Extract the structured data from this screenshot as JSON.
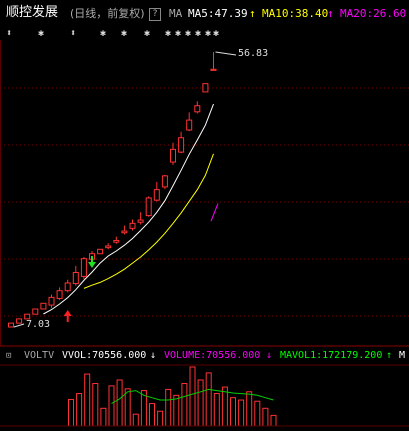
{
  "header": {
    "stock_name": "顺控发展",
    "period_info": "(日线，前复权)",
    "help_icon": "?",
    "ma_label": "MA",
    "ma5": "MA5:47.39",
    "ma10": "MA10:38.40",
    "ma20": "MA20:26.60",
    "up_arrow": "↑"
  },
  "markers": [
    "⬍",
    "✱",
    "⬍",
    "✱",
    "✱",
    "✱",
    "✱",
    "✱",
    "✱",
    "✱",
    "✱",
    "✱"
  ],
  "price_labels": {
    "high": "56.83",
    "low": "7.03"
  },
  "volume_header": {
    "indicator": "VOLTV",
    "vvol": "VVOL:70556.000",
    "volume": "VOLUME:70556.000",
    "mavol1": "MAVOL1:172179.200",
    "mavol_trunc": "M",
    "down_arrow": "↓",
    "up_arrow": "↑"
  },
  "colors": {
    "up": "#ff3232",
    "ma5": "#ffffff",
    "ma10": "#ffff00",
    "ma20": "#ff00ff",
    "grid": "#7a0000",
    "buy_signal": "#ff2020",
    "sell_signal": "#20e020",
    "vol_ma": "#00d000"
  },
  "chart_data": {
    "type": "candlestick",
    "price_range": [
      7.03,
      56.83
    ],
    "candles": [
      {
        "open": 7.03,
        "close": 7.73,
        "high": 7.73,
        "low": 7.03
      },
      {
        "open": 7.73,
        "close": 8.5,
        "high": 8.5,
        "low": 7.73
      },
      {
        "open": 8.5,
        "close": 9.35,
        "high": 9.35,
        "low": 8.5
      },
      {
        "open": 9.35,
        "close": 10.29,
        "high": 10.29,
        "low": 9.35
      },
      {
        "open": 10.29,
        "close": 11.32,
        "high": 11.32,
        "low": 10.29
      },
      {
        "open": 11.0,
        "close": 12.4,
        "high": 12.9,
        "low": 10.5
      },
      {
        "open": 12.2,
        "close": 13.6,
        "high": 14.2,
        "low": 11.9
      },
      {
        "open": 13.6,
        "close": 15.0,
        "high": 15.6,
        "low": 13.3
      },
      {
        "open": 14.9,
        "close": 16.9,
        "high": 18.1,
        "low": 14.5
      },
      {
        "open": 16.2,
        "close": 19.4,
        "high": 19.7,
        "low": 15.7
      },
      {
        "open": 19.3,
        "close": 20.3,
        "high": 20.8,
        "low": 18.9
      },
      {
        "open": 20.3,
        "close": 21.1,
        "high": 21.1,
        "low": 20.3
      },
      {
        "open": 21.4,
        "close": 21.7,
        "high": 22.2,
        "low": 21.1
      },
      {
        "open": 22.4,
        "close": 22.7,
        "high": 23.4,
        "low": 22.1
      },
      {
        "open": 24.1,
        "close": 24.4,
        "high": 25.4,
        "low": 23.8
      },
      {
        "open": 24.9,
        "close": 25.8,
        "high": 26.5,
        "low": 24.5
      },
      {
        "open": 26.0,
        "close": 26.4,
        "high": 27.8,
        "low": 25.6
      },
      {
        "open": 27.2,
        "close": 30.4,
        "high": 30.7,
        "low": 27.0
      },
      {
        "open": 30.0,
        "close": 31.9,
        "high": 33.3,
        "low": 29.8
      },
      {
        "open": 32.4,
        "close": 34.4,
        "high": 34.6,
        "low": 32.0
      },
      {
        "open": 36.9,
        "close": 39.2,
        "high": 40.4,
        "low": 36.4
      },
      {
        "open": 38.7,
        "close": 41.3,
        "high": 42.4,
        "low": 38.5
      },
      {
        "open": 42.7,
        "close": 44.5,
        "high": 45.9,
        "low": 42.5
      },
      {
        "open": 46.0,
        "close": 47.1,
        "high": 47.9,
        "low": 45.7
      },
      {
        "open": 49.6,
        "close": 51.1,
        "high": 51.1,
        "low": 49.6
      },
      {
        "open": 53.5,
        "close": 53.7,
        "high": 56.83,
        "low": 53.5
      }
    ],
    "ma5": [
      null,
      null,
      null,
      null,
      9.38,
      10.18,
      11.2,
      12.36,
      13.78,
      15.46,
      16.98,
      18.6,
      19.88,
      20.8,
      21.84,
      23.06,
      24.5,
      26.0,
      27.8,
      29.9,
      32.6,
      35.4,
      38.3,
      40.9,
      43.6,
      47.39
    ],
    "ma10": [
      null,
      null,
      null,
      null,
      null,
      null,
      null,
      null,
      null,
      14.02,
      14.6,
      15.1,
      15.8,
      16.6,
      17.5,
      18.6,
      19.7,
      21.0,
      22.4,
      24.0,
      25.8,
      27.7,
      29.8,
      31.9,
      34.5,
      38.4
    ],
    "volume": [
      0.45,
      0.55,
      0.88,
      0.72,
      0.3,
      0.68,
      0.78,
      0.63,
      0.2,
      0.6,
      0.38,
      0.25,
      0.62,
      0.52,
      0.72,
      1.0,
      0.78,
      0.9,
      0.55,
      0.66,
      0.48,
      0.44,
      0.58,
      0.42,
      0.3,
      0.18
    ],
    "vol_ma": [
      null,
      null,
      null,
      null,
      null,
      0.38,
      0.46,
      0.58,
      0.6,
      0.52,
      0.48,
      0.44,
      0.44,
      0.46,
      0.5,
      0.54,
      0.58,
      0.62,
      0.6,
      0.58,
      0.56,
      0.55,
      0.54,
      0.52,
      0.48,
      0.44
    ],
    "ma20_marker": [
      26.2,
      29.4
    ]
  }
}
